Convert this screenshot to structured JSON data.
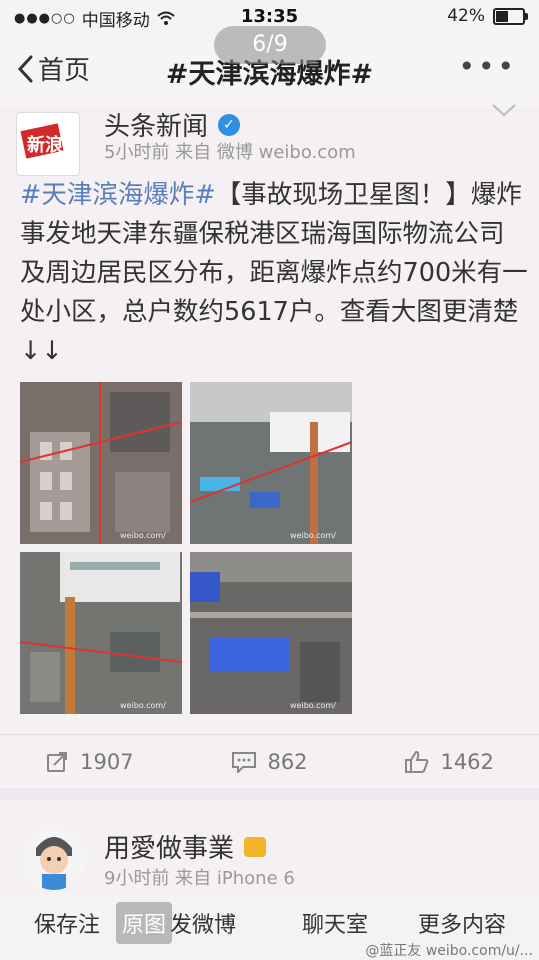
{
  "status_bar": {
    "carrier": "中国移动",
    "time": "13:35",
    "battery": "42%",
    "battery_level": 0.42
  },
  "nav": {
    "back_label": "首页",
    "title": "#天津滨海爆炸#",
    "more": "•••",
    "page_indicator": "6/9"
  },
  "post": {
    "avatar_text": "新浪",
    "author": "头条新闻",
    "meta": "5小时前  来自 微博 weibo.com",
    "hashtag": "#天津滨海爆炸#",
    "body": "【事故现场卫星图！】爆炸事发地天津东疆保税港区瑞海国际物流公司及周边居民区分布，距离爆炸点约700米有一处小区，总户数约5617户。查看大图更清楚↓↓",
    "images": [
      {
        "name": "satellite-image-1",
        "watermark": "weibo.com/"
      },
      {
        "name": "satellite-image-2",
        "watermark": "weibo.com/"
      },
      {
        "name": "satellite-image-3",
        "watermark": "weibo.com/"
      },
      {
        "name": "satellite-image-4",
        "watermark": "weibo.com/"
      }
    ],
    "repost_count": "1907",
    "comment_count": "862",
    "like_count": "1462"
  },
  "post2": {
    "author": "用愛做事業",
    "meta": "9小时前  来自 iPhone 6"
  },
  "toolbar": {
    "save": "保存",
    "save_suffix": "注",
    "original": "原图",
    "send": "发微博",
    "chat": "聊天",
    "chat_suffix": "室",
    "more": "更多内容"
  },
  "watermark": "@蓝正友 weibo.com/u/..."
}
